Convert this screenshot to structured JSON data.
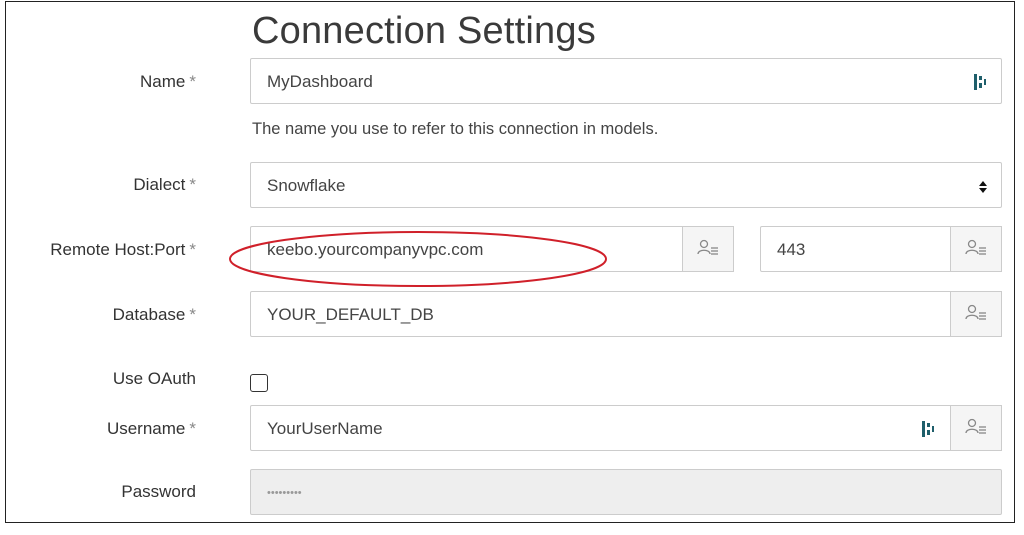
{
  "title": "Connection Settings",
  "required_marker": "*",
  "fields": {
    "name": {
      "label": "Name",
      "value": "MyDashboard",
      "help": "The name you use to refer to this connection in models."
    },
    "dialect": {
      "label": "Dialect",
      "value": "Snowflake"
    },
    "host": {
      "label": "Remote Host:Port",
      "value": "keebo.yourcompanyvpc.com",
      "port": "443"
    },
    "database": {
      "label": "Database",
      "value": "YOUR_DEFAULT_DB"
    },
    "oauth": {
      "label": "Use OAuth",
      "checked": false
    },
    "username": {
      "label": "Username",
      "value": "YourUserName"
    },
    "password": {
      "label": "Password",
      "value": "•••••••••"
    }
  },
  "icons": {
    "field_icon": "user-attribute-icon",
    "keychain": "password-manager-icon",
    "select": "sort-caret-icon"
  },
  "colors": {
    "highlight_ellipse": "#d0202a",
    "keychain_icon": "#1f5f6b"
  }
}
